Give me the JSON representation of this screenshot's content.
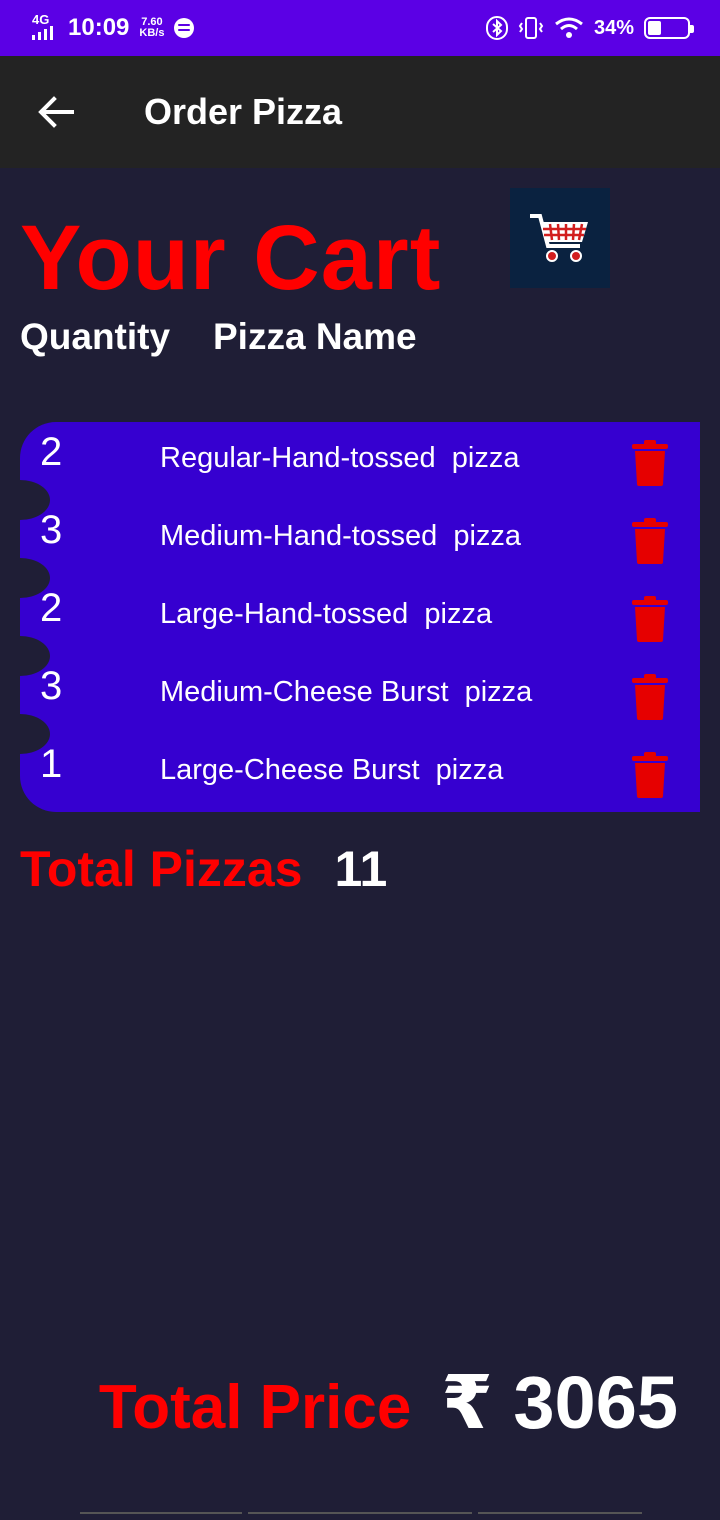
{
  "status_bar": {
    "network": "4G",
    "time": "10:09",
    "speed_value": "7.60",
    "speed_unit": "KB/s",
    "battery": "34%",
    "battery_level": 0.34
  },
  "app_bar": {
    "title": "Order Pizza"
  },
  "cart": {
    "title": "Your Cart",
    "quantity_header": "Quantity",
    "name_header": "Pizza Name",
    "items": [
      {
        "qty": "2",
        "name": "Regular-Hand-tossed  pizza"
      },
      {
        "qty": "3",
        "name": "Medium-Hand-tossed  pizza"
      },
      {
        "qty": "2",
        "name": "Large-Hand-tossed  pizza"
      },
      {
        "qty": "3",
        "name": "Medium-Cheese Burst  pizza"
      },
      {
        "qty": "1",
        "name": "Large-Cheese Burst  pizza"
      }
    ],
    "total_pizzas_label": "Total Pizzas",
    "total_pizzas_value": "11",
    "total_price_label": "Total Price",
    "total_price_value": "₹ 3065"
  },
  "colors": {
    "background": "#1f1e36",
    "status_bar": "#5b00e5",
    "app_bar": "#232323",
    "accent_red": "#ff0000",
    "list_bg": "#3600d0",
    "delete_icon": "#e60000"
  }
}
